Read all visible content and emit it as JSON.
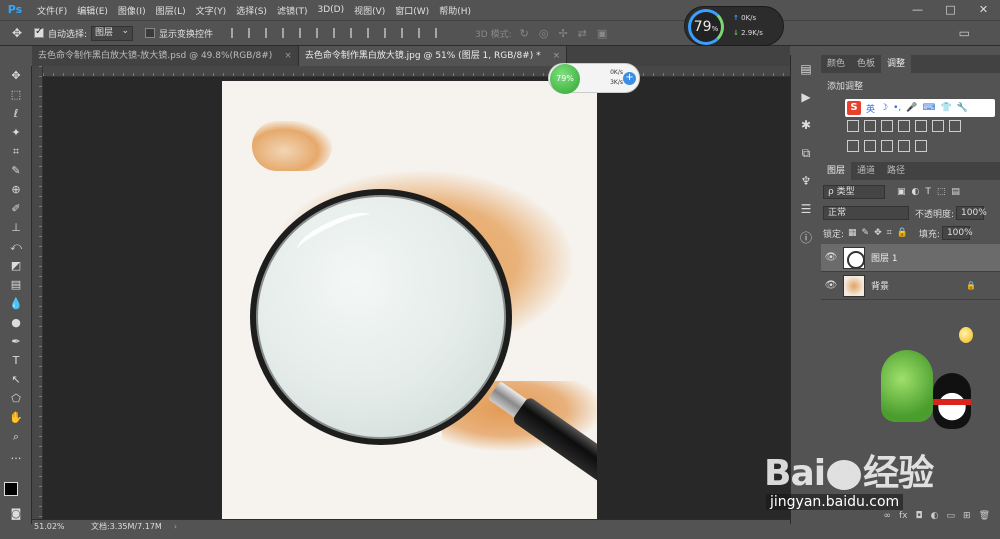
{
  "app": {
    "logo": "Ps",
    "menu": [
      "文件(F)",
      "编辑(E)",
      "图像(I)",
      "图层(L)",
      "文字(Y)",
      "选择(S)",
      "滤镜(T)",
      "3D(D)",
      "视图(V)",
      "窗口(W)",
      "帮助(H)"
    ],
    "window_controls": [
      "—",
      "□",
      "✕"
    ]
  },
  "options": {
    "tool_icon": "move-icon",
    "auto_select_label": "自动选择:",
    "auto_select_value": "图层",
    "show_transform_label": "显示变换控件",
    "mode3d_label": "3D 模式:"
  },
  "perf": {
    "percent": "79",
    "unit": "%",
    "up": "0K/s",
    "down": "2.9K/s"
  },
  "tabs": [
    {
      "label": "去色命令制作黑白放大镜-放大镜.psd @ 49.8%(RGB/8#)",
      "close": "×"
    },
    {
      "label": "去色命令制作黑白放大镜.jpg @ 51% (图层 1, RGB/8#) *",
      "close": "×"
    }
  ],
  "net_widget": {
    "percent": "79%",
    "up": "0K/s",
    "down": "3K/s",
    "plus": "+"
  },
  "panels": {
    "top_tabs": [
      "颜色",
      "色板",
      "调整"
    ],
    "adjust_title": "添加调整",
    "ime": {
      "logo": "S",
      "items": [
        "英",
        "☽",
        "•,",
        "🎤",
        "⌨",
        "👕",
        "🔧"
      ]
    },
    "layer_tabs": [
      "图层",
      "通道",
      "路径"
    ],
    "filter_type": "ρ 类型",
    "blend_mode": "正常",
    "opacity_label": "不透明度:",
    "opacity_value": "100%",
    "lock_label": "锁定:",
    "fill_label": "填充:",
    "fill_value": "100%",
    "layers": [
      {
        "name": "图层 1",
        "selected": true
      },
      {
        "name": "背景",
        "selected": false,
        "locked": true
      }
    ],
    "bottom_icons": [
      "∞",
      "fx",
      "◘",
      "◐",
      "▭",
      "⊞",
      "🗑"
    ]
  },
  "status": {
    "zoom": "51.02%",
    "doc": "文档:3.35M/7.17M",
    "arrow": "›"
  },
  "watermark": {
    "logo_left": "Bai",
    "logo_right": "经验",
    "url": "jingyan.baidu.com"
  }
}
